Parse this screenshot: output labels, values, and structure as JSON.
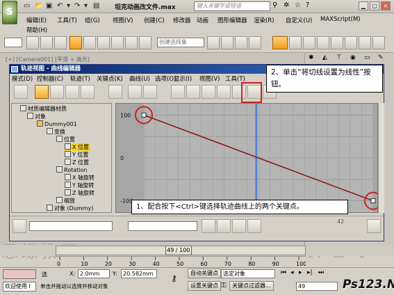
{
  "app": {
    "title": "坦克动画改文件.max",
    "title_suffix": "·",
    "search_placeholder": "键入关键字或短语",
    "logo_letter": "S"
  },
  "menu": {
    "items": [
      "编辑(E)",
      "工具(T)",
      "组(G)",
      "视图(V)",
      "创建(C)",
      "修改器",
      "动画",
      "图形编辑器",
      "渲染(R)",
      "自定义(U)",
      "MAXScript(M)"
    ],
    "help": "帮助(H)"
  },
  "toolbar": {
    "selection_set_placeholder": "创建选择集",
    "view_dropdown": "视图"
  },
  "viewport": {
    "label": "[+] [Camera001] [平滑 + 高光]"
  },
  "track_view": {
    "title": "轨迹视图 - 曲线编辑器",
    "menu": [
      "模式(D)",
      "控制器(C)",
      "轨迹(T)",
      "关键点(K)",
      "曲线(U)",
      "选项(O)",
      "显示(I)",
      "视图(V)",
      "工具(T)"
    ],
    "tree": [
      {
        "label": "材质编辑器材质",
        "level": 0
      },
      {
        "label": "对象",
        "level": 0
      },
      {
        "label": "Dummy001",
        "level": 1
      },
      {
        "label": "变换",
        "level": 2
      },
      {
        "label": "位置",
        "level": 3
      },
      {
        "label": "X 位置",
        "level": 4,
        "selected": true
      },
      {
        "label": "Y 位置",
        "level": 4
      },
      {
        "label": "Z 位置",
        "level": 4
      },
      {
        "label": "Rotation",
        "level": 3
      },
      {
        "label": "X 轴旋转",
        "level": 4
      },
      {
        "label": "Y 轴旋转",
        "level": 4
      },
      {
        "label": "Z 轴旋转",
        "level": 4
      },
      {
        "label": "缩放",
        "level": 3
      },
      {
        "label": "对象 (Dummy)",
        "level": 2
      }
    ],
    "axis_labels": {
      "top": "100",
      "middle": "0",
      "bottom": "-100"
    },
    "bottom_value": "42"
  },
  "callouts": {
    "step2": "2、单击“将切线设置为线性”按钮。",
    "step1": "1、配合按下<Ctrl>键选择轨迹曲线上的两个关键点。"
  },
  "timeline": {
    "slider": "49 / 100",
    "ticks": [
      "0",
      "10",
      "20",
      "30",
      "40",
      "50",
      "60",
      "70",
      "80",
      "90",
      "100"
    ]
  },
  "status": {
    "welcome": "欢迎使用 I",
    "prompt": "单击并拖动以选择并移动对象",
    "sel_label": "选",
    "x_label": "X:",
    "x_value": "2.0mm",
    "y_label": "Y:",
    "y_value": "20.582mm",
    "autokey": "自动关键点",
    "autokey_target": "选定对象",
    "setkey": "设置关键点",
    "key_filters": "关键点过滤器...",
    "frame": "49",
    "brand": "Ps123.Net"
  },
  "chart_data": {
    "type": "line",
    "title": "",
    "xlabel": "",
    "ylabel": "",
    "xlim": [
      0,
      100
    ],
    "ylim": [
      -120,
      120
    ],
    "current_frame": 49,
    "series": [
      {
        "name": "X 位置",
        "color": "#8b1a1a",
        "x": [
          0,
          100
        ],
        "y": [
          100,
          -100
        ]
      }
    ],
    "ticks_y": [
      "100",
      "0",
      "-100"
    ]
  },
  "colors": {
    "curve": "#8b1a1a",
    "highlight_circle": "#cc2020",
    "time_line": "#3a7ad0",
    "title_blue": "#0a246a"
  }
}
